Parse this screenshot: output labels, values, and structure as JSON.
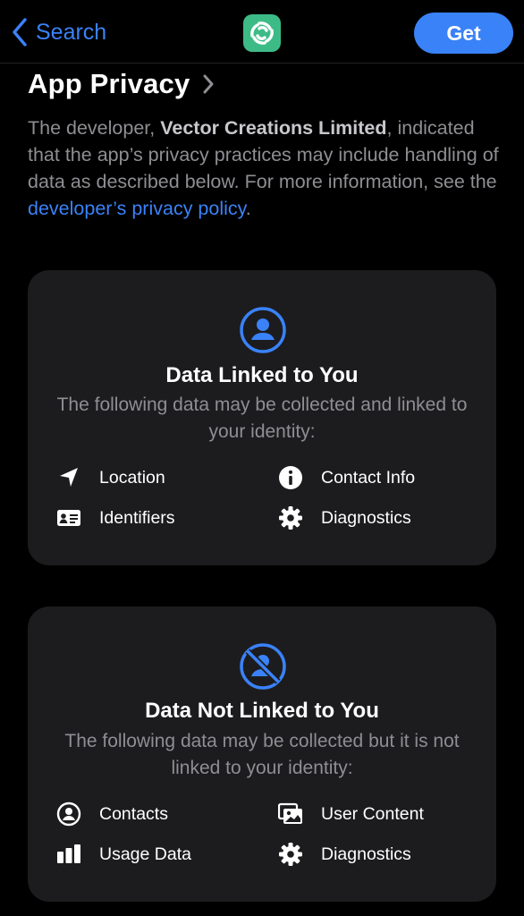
{
  "nav": {
    "back_label": "Search",
    "get_label": "Get"
  },
  "section": {
    "title": "App Privacy"
  },
  "description": {
    "prefix": "The developer, ",
    "developer": "Vector Creations Limited",
    "middle": ", indicated that the app’s privacy practices may include handling of data as described below. For more information, see the ",
    "link": "developer’s privacy policy",
    "suffix": "."
  },
  "linked": {
    "title": "Data Linked to You",
    "subtitle": "The following data may be collected and linked to your identity:",
    "items": [
      {
        "label": "Location",
        "icon": "location-arrow-icon"
      },
      {
        "label": "Contact Info",
        "icon": "info-icon"
      },
      {
        "label": "Identifiers",
        "icon": "id-card-icon"
      },
      {
        "label": "Diagnostics",
        "icon": "gear-icon"
      }
    ]
  },
  "not_linked": {
    "title": "Data Not Linked to You",
    "subtitle": "The following data may be collected but it is not linked to your identity:",
    "items": [
      {
        "label": "Contacts",
        "icon": "person-circle-icon"
      },
      {
        "label": "User Content",
        "icon": "photos-icon"
      },
      {
        "label": "Usage Data",
        "icon": "bar-chart-icon"
      },
      {
        "label": "Diagnostics",
        "icon": "gear-icon"
      }
    ]
  },
  "colors": {
    "accent": "#3a82f7",
    "card": "#1c1c1e",
    "secondary_text": "#8e8e93",
    "app_icon": "#3dbb87"
  }
}
